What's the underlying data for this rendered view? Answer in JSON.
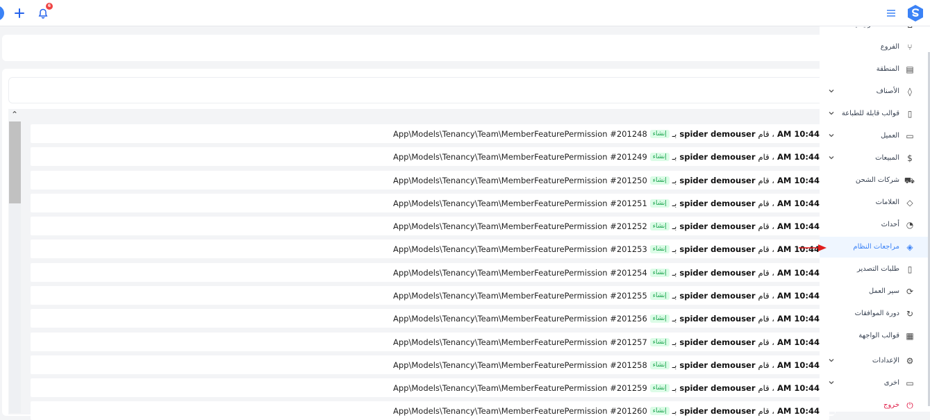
{
  "header": {
    "notification_count": "6",
    "menu_icon": "hamburger-icon",
    "logo_icon": "brand-logo"
  },
  "sidebar": {
    "items": [
      {
        "label": "الصفحة الرئيسية",
        "icon": "home-icon",
        "chevron": false,
        "active": false
      },
      {
        "label": "الفروع",
        "icon": "branch-icon",
        "chevron": false,
        "active": false
      },
      {
        "label": "المنطقة",
        "icon": "map-icon",
        "chevron": false,
        "active": false
      },
      {
        "label": "الأصناف",
        "icon": "leaf-icon",
        "chevron": true,
        "active": false
      },
      {
        "label": "قوالب قابلة للطباعة",
        "icon": "document-icon",
        "chevron": true,
        "active": false
      },
      {
        "label": "العميل",
        "icon": "customer-icon",
        "chevron": true,
        "active": false
      },
      {
        "label": "المبيعات",
        "icon": "currency-icon",
        "chevron": true,
        "active": false
      },
      {
        "label": "شركات الشحن",
        "icon": "truck-icon",
        "chevron": false,
        "active": false
      },
      {
        "label": "العلامات",
        "icon": "tag-icon",
        "chevron": false,
        "active": false
      },
      {
        "label": "أحداث",
        "icon": "event-icon",
        "chevron": false,
        "active": false
      },
      {
        "label": "مراجعات النظام",
        "icon": "audit-icon",
        "chevron": false,
        "active": true
      },
      {
        "label": "طلبات التصدير",
        "icon": "export-icon",
        "chevron": false,
        "active": false
      },
      {
        "label": "سير العمل",
        "icon": "workflow-icon",
        "chevron": false,
        "active": false
      },
      {
        "label": "دورة الموافقات",
        "icon": "cycle-icon",
        "chevron": false,
        "active": false
      },
      {
        "label": "قوالب الواجهة",
        "icon": "template-icon",
        "chevron": false,
        "active": false
      },
      {
        "label": "الإعدادات",
        "icon": "gear-icon",
        "chevron": true,
        "active": false
      },
      {
        "label": "اخرى",
        "icon": "rectangle-icon",
        "chevron": true,
        "active": false
      },
      {
        "label": "خروج",
        "icon": "power-icon",
        "chevron": false,
        "active": false
      }
    ]
  },
  "audit": {
    "rows": [
      {
        "time": "AM 10:44",
        "sep": "، قام",
        "actor": "spider demouser",
        "by": "بـ",
        "action": "إنشاء",
        "model": "App\\Models\\Tenancy\\Team\\MemberFeaturePermission #201248"
      },
      {
        "time": "AM 10:44",
        "sep": "، قام",
        "actor": "spider demouser",
        "by": "بـ",
        "action": "إنشاء",
        "model": "App\\Models\\Tenancy\\Team\\MemberFeaturePermission #201249"
      },
      {
        "time": "AM 10:44",
        "sep": "، قام",
        "actor": "spider demouser",
        "by": "بـ",
        "action": "إنشاء",
        "model": "App\\Models\\Tenancy\\Team\\MemberFeaturePermission #201250"
      },
      {
        "time": "AM 10:44",
        "sep": "، قام",
        "actor": "spider demouser",
        "by": "بـ",
        "action": "إنشاء",
        "model": "App\\Models\\Tenancy\\Team\\MemberFeaturePermission #201251"
      },
      {
        "time": "AM 10:44",
        "sep": "، قام",
        "actor": "spider demouser",
        "by": "بـ",
        "action": "إنشاء",
        "model": "App\\Models\\Tenancy\\Team\\MemberFeaturePermission #201252"
      },
      {
        "time": "AM 10:44",
        "sep": "، قام",
        "actor": "spider demouser",
        "by": "بـ",
        "action": "إنشاء",
        "model": "App\\Models\\Tenancy\\Team\\MemberFeaturePermission #201253"
      },
      {
        "time": "AM 10:44",
        "sep": "، قام",
        "actor": "spider demouser",
        "by": "بـ",
        "action": "إنشاء",
        "model": "App\\Models\\Tenancy\\Team\\MemberFeaturePermission #201254"
      },
      {
        "time": "AM 10:44",
        "sep": "، قام",
        "actor": "spider demouser",
        "by": "بـ",
        "action": "إنشاء",
        "model": "App\\Models\\Tenancy\\Team\\MemberFeaturePermission #201255"
      },
      {
        "time": "AM 10:44",
        "sep": "، قام",
        "actor": "spider demouser",
        "by": "بـ",
        "action": "إنشاء",
        "model": "App\\Models\\Tenancy\\Team\\MemberFeaturePermission #201256"
      },
      {
        "time": "AM 10:44",
        "sep": "، قام",
        "actor": "spider demouser",
        "by": "بـ",
        "action": "إنشاء",
        "model": "App\\Models\\Tenancy\\Team\\MemberFeaturePermission #201257"
      },
      {
        "time": "AM 10:44",
        "sep": "، قام",
        "actor": "spider demouser",
        "by": "بـ",
        "action": "إنشاء",
        "model": "App\\Models\\Tenancy\\Team\\MemberFeaturePermission #201258"
      },
      {
        "time": "AM 10:44",
        "sep": "، قام",
        "actor": "spider demouser",
        "by": "بـ",
        "action": "إنشاء",
        "model": "App\\Models\\Tenancy\\Team\\MemberFeaturePermission #201259"
      },
      {
        "time": "AM 10:44",
        "sep": "، قام",
        "actor": "spider demouser",
        "by": "بـ",
        "action": "إنشاء",
        "model": "App\\Models\\Tenancy\\Team\\MemberFeaturePermission #201260"
      }
    ]
  },
  "colors": {
    "accent": "#3b82f6",
    "badge": "#ef4444",
    "tag_bg": "#dcfce7",
    "tag_text": "#16a34a",
    "logout": "#e11d48",
    "pointer_arrow": "#e11d1d"
  }
}
